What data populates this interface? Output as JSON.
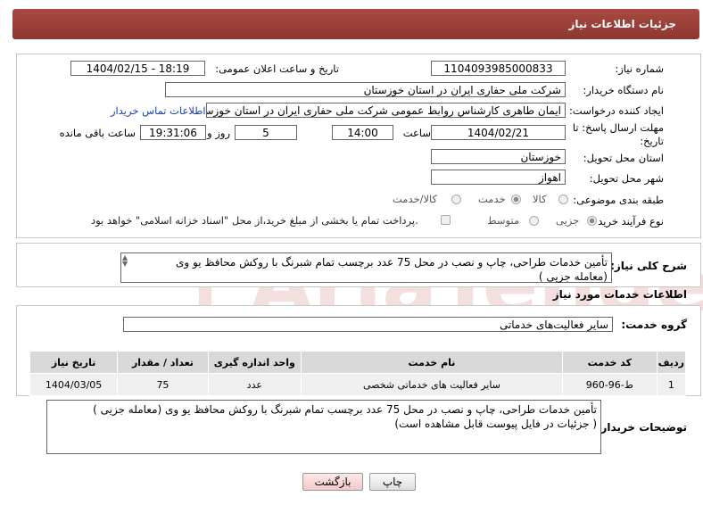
{
  "header": {
    "title": "جزئیات اطلاعات نیاز"
  },
  "form": {
    "need_number_label": "شماره نیاز:",
    "need_number": "1104093985000833",
    "announce_label": "تاریخ و ساعت اعلان عمومی:",
    "announce_value": "1404/02/15 - 18:19",
    "buyer_org_label": "نام دستگاه خریدار:",
    "buyer_org": "شرکت ملی حفاری ایران در استان خوزستان",
    "requester_label": "ایجاد کننده درخواست:",
    "requester": "ایمان طاهری کارشناس روابط عمومی شرکت ملی حفاری ایران در استان خوزستان",
    "contact_link": "اطلاعات تماس خریدار",
    "deadline_label_1": "مهلت ارسال پاسخ: تا",
    "deadline_label_2": "تاریخ:",
    "deadline_date": "1404/02/21",
    "time_label": "ساعت",
    "deadline_time": "14:00",
    "days_value": "5",
    "days_label": "روز و",
    "remaining_time": "19:31:06",
    "remaining_label": "ساعت باقی مانده",
    "province_label": "استان محل تحویل:",
    "province": "خوزستان",
    "city_label": "شهر محل تحویل:",
    "city": "اهواز",
    "category_label": "طبقه بندی موضوعی:",
    "category_options": [
      "کالا",
      "خدمت",
      "کالا/خدمت"
    ],
    "category_selected": "خدمت",
    "process_label": "نوع فرآیند خرید :",
    "process_options": [
      "جزیی",
      "متوسط"
    ],
    "process_selected": "جزیی",
    "payment_note": "پرداخت تمام یا بخشی از مبلغ خرید،از محل \"اسناد خزانه اسلامی\" خواهد بود."
  },
  "summary": {
    "label": "شرح کلی نیاز:",
    "text": "تأمین خدمات طراحی، چاپ و نصب در محل 75 عدد برچسب تمام شبرنگ با روکش محافظ یو وی (معامله جزیی )"
  },
  "services": {
    "section_title": "اطلاعات خدمات مورد نیاز",
    "group_label": "گروه خدمت:",
    "group_value": "سایر فعالیت‌های خدماتی",
    "columns": [
      "ردیف",
      "کد خدمت",
      "نام خدمت",
      "واحد اندازه گیری",
      "تعداد / مقدار",
      "تاریخ نیاز"
    ],
    "rows": [
      {
        "row": "1",
        "code": "ط-96-960",
        "name": "سایر فعالیت های خدماتی شخصی",
        "unit": "عدد",
        "qty": "75",
        "date": "1404/03/05"
      }
    ]
  },
  "buyer_notes": {
    "label": "توضیحات خریدار:",
    "line1": "تأمین خدمات طراحی، چاپ و نصب در محل 75 عدد برچسب تمام شبرنگ با روکش محافظ یو وی (معامله جزیی )",
    "line2": "( جزئیات در فایل پیوست قابل مشاهده است)"
  },
  "buttons": {
    "print": "چاپ",
    "back": "بازگشت"
  },
  "colors": {
    "header": "#9c4038",
    "link": "#1a3fb0"
  }
}
